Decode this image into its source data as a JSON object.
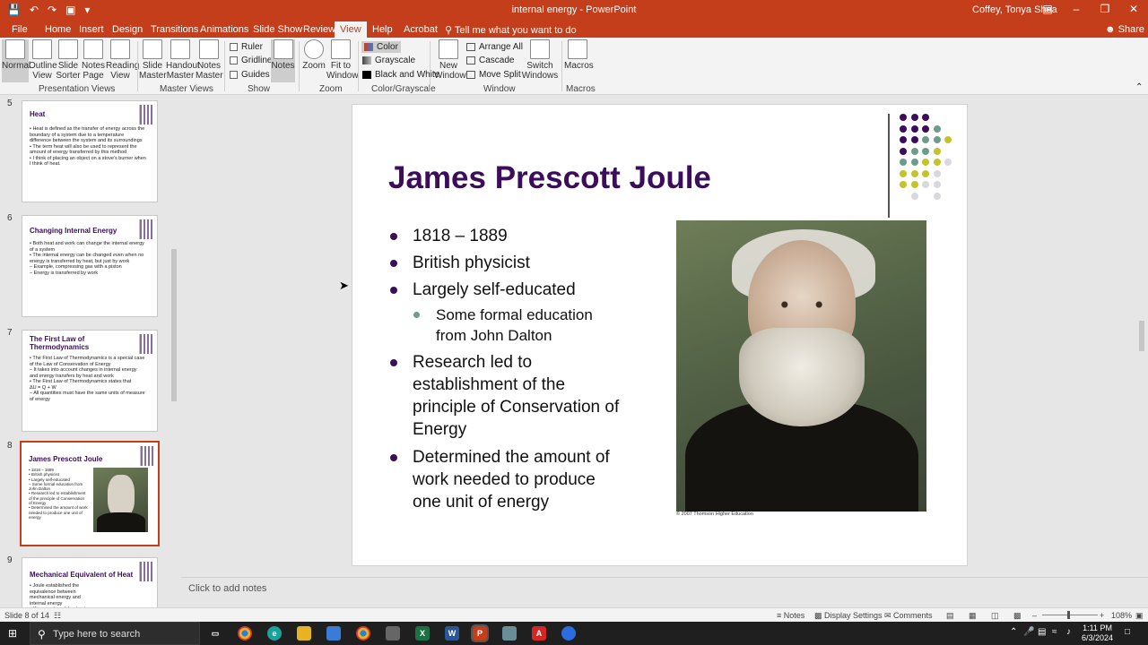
{
  "titlebar": {
    "document_title": "internal energy  -  PowerPoint",
    "user": "Coffey, Tonya Shea",
    "accent_color": "#c43e1c"
  },
  "tabs": [
    "File",
    "Home",
    "Insert",
    "Design",
    "Transitions",
    "Animations",
    "Slide Show",
    "Review",
    "View",
    "Help",
    "Acrobat"
  ],
  "active_tab": "View",
  "tell_me": "Tell me what you want to do",
  "share": "Share",
  "ribbon": {
    "presentation_views": {
      "label": "Presentation Views",
      "items": [
        "Normal",
        "Outline View",
        "Slide Sorter",
        "Notes Page",
        "Reading View"
      ]
    },
    "master_views": {
      "label": "Master Views",
      "items": [
        "Slide Master",
        "Handout Master",
        "Notes Master"
      ]
    },
    "show": {
      "label": "Show",
      "ruler": "Ruler",
      "gridlines": "Gridlines",
      "guides": "Guides",
      "notes": "Notes"
    },
    "zoom": {
      "label": "Zoom",
      "zoom": "Zoom",
      "fit": "Fit to Window"
    },
    "color": {
      "label": "Color/Grayscale",
      "color": "Color",
      "grayscale": "Grayscale",
      "bw": "Black and White"
    },
    "window": {
      "label": "Window",
      "new_window": "New Window",
      "arrange_all": "Arrange All",
      "cascade": "Cascade",
      "move_split": "Move Split",
      "switch": "Switch Windows"
    },
    "macros": {
      "label": "Macros",
      "macros": "Macros"
    }
  },
  "thumbnails": [
    {
      "num": "5",
      "title": "Heat",
      "body": "• Heat is defined as the transfer of energy across the boundary of a system due to a temperature difference between the system and its surroundings\n• The term heat will also be used to represent the amount of energy transferred by this method\n• I think of placing an object on a stove's burner when I think of heat."
    },
    {
      "num": "6",
      "title": "Changing Internal Energy",
      "body": "• Both heat and work can change the internal energy of a system\n• The internal energy can be changed even when no energy is transferred by heat, but just by work\n   – Example, compressing gas with a piston\n   – Energy is transferred by work"
    },
    {
      "num": "7",
      "title": "The First Law of Thermodynamics",
      "body": "• The First Law of Thermodynamics is a special case of the Law of Conservation of Energy\n   – It takes into account changes in internal energy and energy transfers by heat and work\n• The First Law of Thermodynamics states that\n   ΔU = Q + W\n   – All quantities must have the same units of measure of energy"
    },
    {
      "num": "8",
      "title": "James Prescott Joule",
      "body": "• 1818 – 1889\n• British physicist\n• Largely self-educated\n   – Some formal education from John Dalton\n• Research led to establishment of the principle of Conservation of Energy\n• Determined the amount of work needed to produce one unit of energy"
    },
    {
      "num": "9",
      "title": "Mechanical Equivalent of Heat",
      "body": "• Joule established the equivalence between mechanical energy and internal energy\n• His experimental setup is"
    }
  ],
  "slide": {
    "title": "James Prescott Joule",
    "bullets": [
      "1818 – 1889",
      "British physicist",
      "Largely self-educated"
    ],
    "sub_bullet": [
      "Some formal education",
      "from John Dalton"
    ],
    "bullet_research": [
      "Research led to",
      "establishment of the",
      "principle of Conservation of",
      "Energy"
    ],
    "bullet_determined": [
      "Determined the amount of",
      "work needed to produce",
      "one unit of energy"
    ],
    "image_credit": "© 2007 Thomson Higher Education",
    "title_color": "#3b0d5a"
  },
  "notes_placeholder": "Click to add notes",
  "status": {
    "slide_of": "Slide 8 of 14",
    "notes": "Notes",
    "display_settings": "Display Settings",
    "comments": "Comments",
    "zoom": "108%"
  },
  "taskbar": {
    "search_placeholder": "Type here to search",
    "time": "1:11 PM",
    "date": "6/3/2024"
  }
}
